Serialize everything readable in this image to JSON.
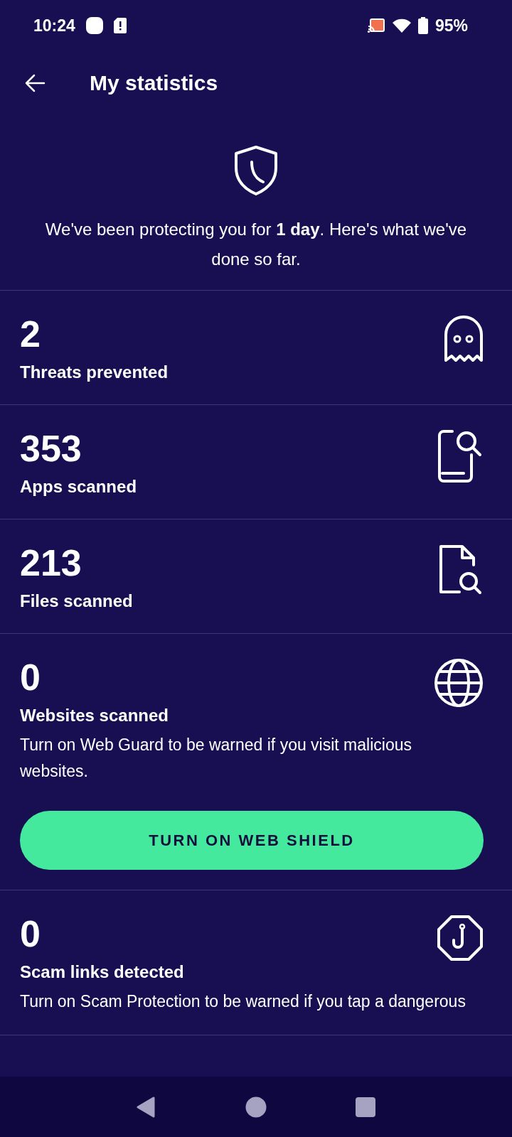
{
  "status_bar": {
    "time": "10:24",
    "battery": "95%"
  },
  "header": {
    "title": "My statistics"
  },
  "intro": "We've been protecting you for **1 day**. Here's what we've done so far.",
  "stats": [
    {
      "kind": "plain",
      "value": "2",
      "label": "Threats prevented"
    },
    {
      "kind": "plain",
      "value": "353",
      "label": "Apps scanned"
    },
    {
      "kind": "plain",
      "value": "213",
      "label": "Files scanned"
    },
    {
      "kind": "action",
      "value": "0",
      "label": "Websites scanned",
      "description": "Turn on Web Guard to be warned if you visit malicious websites.",
      "button": "TURN ON WEB SHIELD"
    },
    {
      "kind": "info",
      "value": "0",
      "label": "Scam links detected",
      "description": "Turn on Scam Protection to be warned if you tap a dangerous"
    }
  ]
}
